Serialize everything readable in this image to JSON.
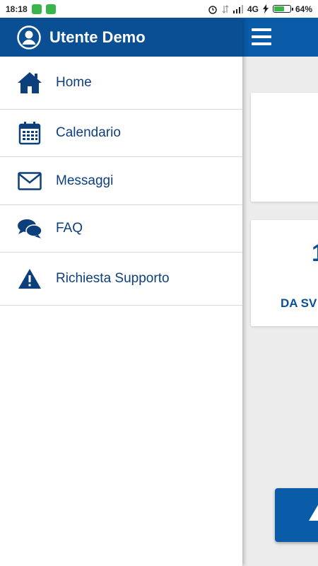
{
  "status_bar": {
    "time": "18:18",
    "network": "4G",
    "battery_percent": "64%",
    "battery_level": 0.64
  },
  "drawer": {
    "user_name": "Utente Demo",
    "items": [
      {
        "label": "Home",
        "icon": "home-icon"
      },
      {
        "label": "Calendario",
        "icon": "calendar-icon"
      },
      {
        "label": "Messaggi",
        "icon": "envelope-icon"
      },
      {
        "label": "FAQ",
        "icon": "chat-bubbles-icon"
      },
      {
        "label": "Richiesta Supporto",
        "icon": "warning-icon"
      }
    ]
  },
  "background": {
    "card2_value": "1",
    "card2_label": "DA SV"
  },
  "colors": {
    "brand_dark": "#0a4f94",
    "brand": "#0a5ca8",
    "menu_text": "#0d3f7d",
    "battery_green": "#39b54a"
  }
}
